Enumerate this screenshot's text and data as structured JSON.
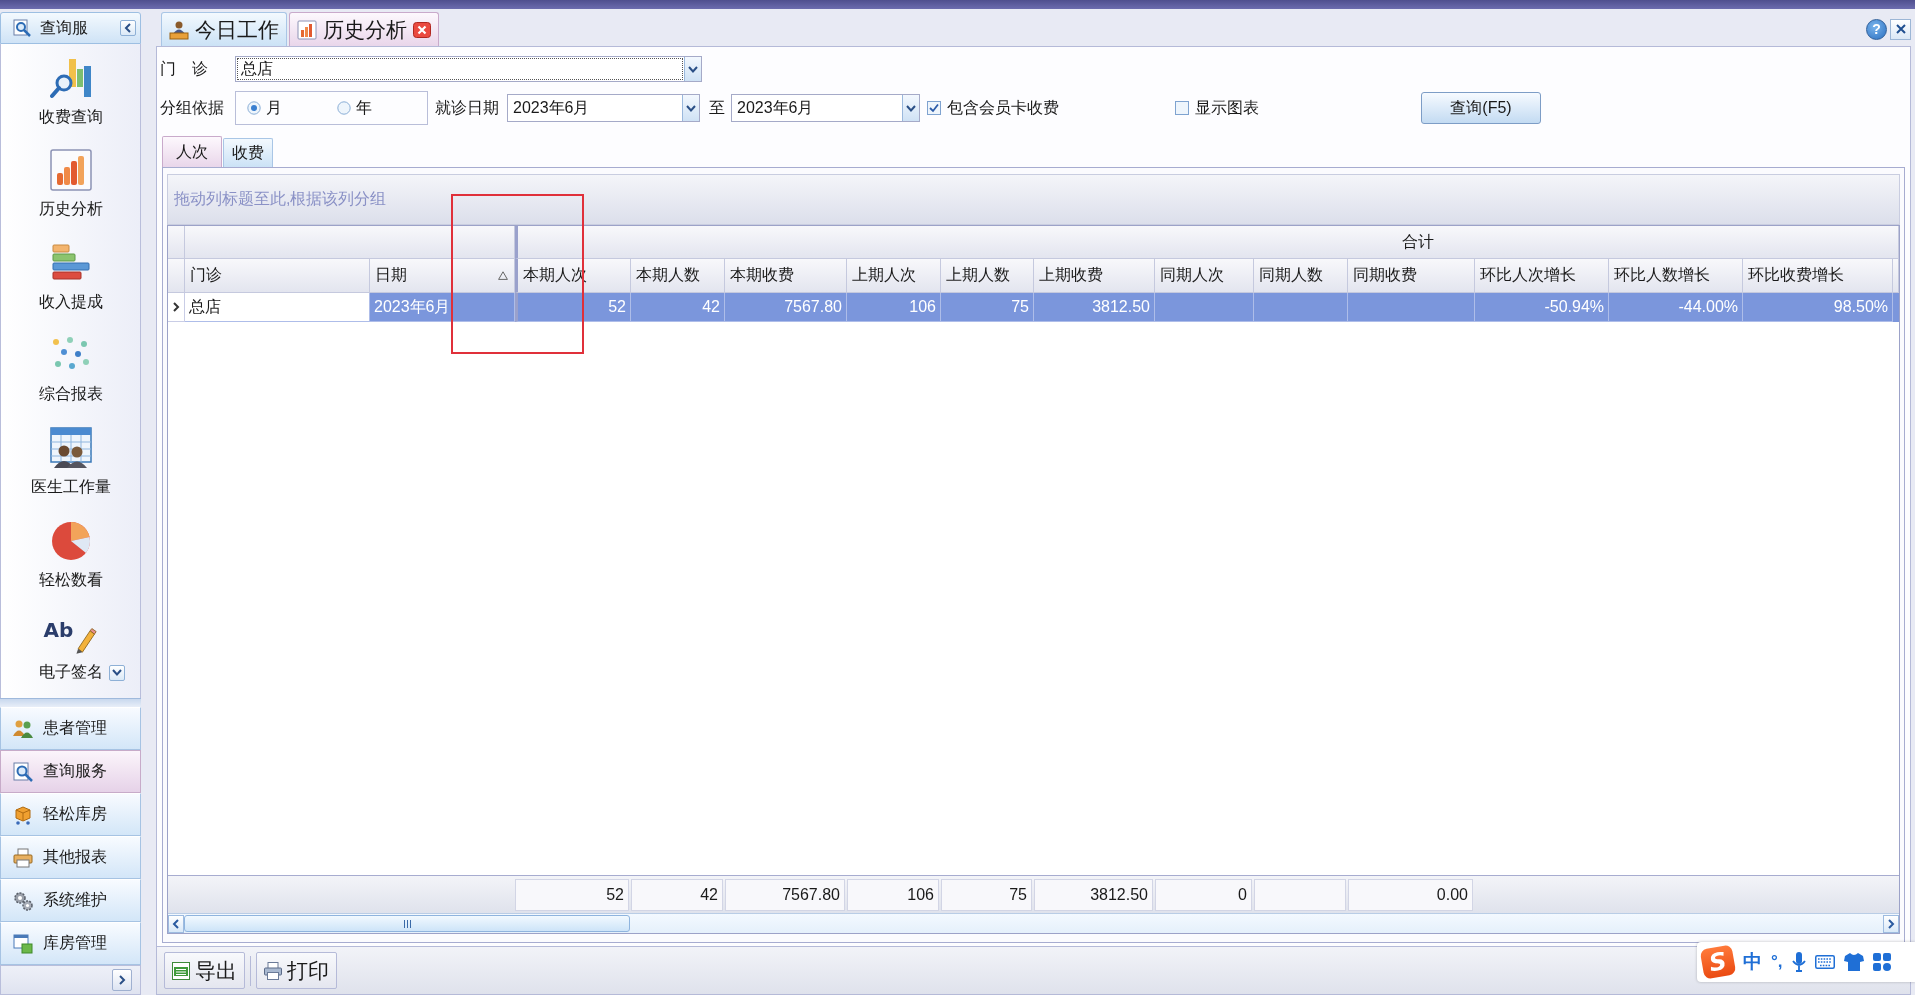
{
  "sidebar": {
    "header": {
      "title": "查询服"
    },
    "items": [
      {
        "label": "收费查询"
      },
      {
        "label": "历史分析"
      },
      {
        "label": "收入提成"
      },
      {
        "label": "综合报表"
      },
      {
        "label": "医生工作量"
      },
      {
        "label": "轻松数看"
      },
      {
        "label": "电子签名",
        "icon_text": "Ab"
      }
    ],
    "nav": [
      {
        "label": "患者管理",
        "selected": false
      },
      {
        "label": "查询服务",
        "selected": true
      },
      {
        "label": "轻松库房",
        "selected": false
      },
      {
        "label": "其他报表",
        "selected": false
      },
      {
        "label": "系统维护",
        "selected": false
      },
      {
        "label": "库房管理",
        "selected": false
      }
    ]
  },
  "tabs": [
    {
      "label": "今日工作",
      "selected": false,
      "closable": false
    },
    {
      "label": "历史分析",
      "selected": true,
      "closable": true
    }
  ],
  "help": "?",
  "filters": {
    "clinic": {
      "label": "门　诊",
      "value": "总店"
    },
    "group_by": {
      "label": "分组依据",
      "options": [
        {
          "label": "月",
          "selected": true
        },
        {
          "label": "年",
          "selected": false
        }
      ]
    },
    "visit_date": {
      "label": "就诊日期",
      "from": "2023年6月",
      "separator": "至",
      "to": "2023年6月"
    },
    "options": [
      {
        "label": "包含会员卡收费",
        "checked": true
      },
      {
        "label": "显示图表",
        "checked": false
      }
    ],
    "query_button": "查询(F5)"
  },
  "view_tabs": [
    {
      "label": "人次",
      "selected": true
    },
    {
      "label": "收费",
      "selected": false
    }
  ],
  "grid": {
    "group_hint": "拖动列标题至此,根据该列分组",
    "bands": [
      {
        "columns": [
          {
            "label": "门诊",
            "kind": "text",
            "sorted": false,
            "summary": false
          },
          {
            "label": "日期",
            "kind": "text",
            "sorted": true,
            "summary": false
          }
        ]
      },
      {
        "label": "合计",
        "columns": [
          {
            "label": "本期人次",
            "kind": "number",
            "sorted": false,
            "summary": true,
            "total": "52"
          },
          {
            "label": "本期人数",
            "kind": "number",
            "sorted": false,
            "summary": true,
            "total": "42"
          },
          {
            "label": "本期收费",
            "kind": "number",
            "sorted": false,
            "summary": true,
            "total": "7567.80"
          },
          {
            "label": "上期人次",
            "kind": "number",
            "sorted": false,
            "summary": true,
            "total": "106"
          },
          {
            "label": "上期人数",
            "kind": "number",
            "sorted": false,
            "summary": true,
            "total": "75"
          },
          {
            "label": "上期收费",
            "kind": "number",
            "sorted": false,
            "summary": true,
            "total": "3812.50"
          },
          {
            "label": "同期人次",
            "kind": "number",
            "sorted": false,
            "summary": true,
            "total": "0"
          },
          {
            "label": "同期人数",
            "kind": "number",
            "sorted": false,
            "summary": true
          },
          {
            "label": "同期收费",
            "kind": "number",
            "sorted": false,
            "summary": true,
            "total": "0.00"
          },
          {
            "label": "环比人次增长",
            "kind": "number",
            "sorted": false,
            "summary": false
          },
          {
            "label": "环比人数增长",
            "kind": "number",
            "sorted": false,
            "summary": false
          },
          {
            "label": "环比收费增长",
            "kind": "number",
            "sorted": false,
            "summary": false
          }
        ]
      }
    ],
    "rows": [
      {
        "selected": true,
        "cells": [
          {
            "text": "总店",
            "focused": true
          },
          {
            "text": "2023年6月",
            "focused": false
          },
          {
            "text": "52",
            "focused": false
          },
          {
            "text": "42",
            "focused": false
          },
          {
            "text": "7567.80",
            "focused": false
          },
          {
            "text": "106",
            "focused": false
          },
          {
            "text": "75",
            "focused": false
          },
          {
            "text": "3812.50",
            "focused": false
          },
          {
            "focused": false
          },
          {
            "focused": false
          },
          {
            "focused": false
          },
          {
            "text": "-50.94%",
            "focused": false
          },
          {
            "text": "-44.00%",
            "focused": false
          },
          {
            "text": "98.50%",
            "focused": false
          }
        ]
      }
    ]
  },
  "toolbar": [
    {
      "label": "导出"
    },
    {
      "label": "打印"
    }
  ],
  "annotations": [
    {
      "kind": "rectangle"
    }
  ],
  "ime_toolbar": {
    "logo": "S",
    "mode": "中",
    "punctuation": "°,"
  }
}
